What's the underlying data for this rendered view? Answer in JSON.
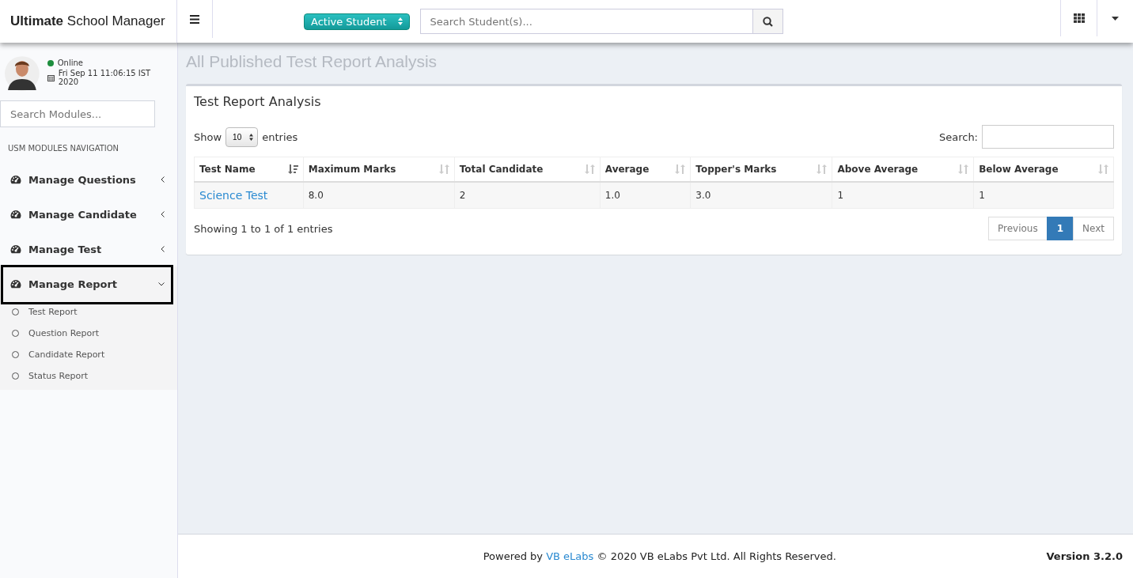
{
  "header": {
    "logo": "**Ultimate** School Manager",
    "status_select": "Active Student",
    "search": {
      "placeholder": "Search Student(s)..."
    }
  },
  "sidebar": {
    "user": {
      "status": "Online",
      "online": true,
      "datetime": "Fri Sep 11 11:06:15 IST 2020"
    },
    "search": {
      "placeholder": "Search Modules..."
    },
    "section": "USM MODULES NAVIGATION",
    "items": [
      {
        "label": "Manage Questions",
        "expanded": false,
        "highlighted": false
      },
      {
        "label": "Manage Candidate",
        "expanded": false,
        "highlighted": false
      },
      {
        "label": "Manage Test",
        "expanded": false,
        "highlighted": false
      },
      {
        "label": "Manage Report",
        "expanded": true,
        "highlighted": true,
        "children": [
          {
            "label": "Test Report"
          },
          {
            "label": "Question Report"
          },
          {
            "label": "Candidate Report"
          },
          {
            "label": "Status Report"
          }
        ]
      }
    ]
  },
  "page_title": "All Published Test Report Analysis",
  "panel": {
    "title": "Test Report Analysis",
    "length": {
      "before": "Show",
      "value": "10",
      "after": "entries"
    },
    "search_label": "Search:",
    "table": {
      "columns": [
        {
          "label": "Test Name",
          "sorted": true
        },
        {
          "label": "Maximum Marks",
          "sorted": false
        },
        {
          "label": "Total Candidate",
          "sorted": false
        },
        {
          "label": "Average",
          "sorted": false
        },
        {
          "label": "Topper's Marks",
          "sorted": false
        },
        {
          "label": "Above Average",
          "sorted": false
        },
        {
          "label": "Below Average",
          "sorted": false
        }
      ],
      "rows": [
        [
          "Science Test",
          "8.0",
          "2",
          "1.0",
          "3.0",
          "1",
          "1"
        ]
      ]
    },
    "info": "Showing 1 to 1 of 1 entries",
    "pagination": [
      {
        "label": "Previous",
        "kind": "nav",
        "selected": false
      },
      {
        "label": "1",
        "kind": "page",
        "selected": true
      },
      {
        "label": "Next",
        "kind": "nav",
        "selected": false
      }
    ]
  },
  "footer": {
    "before": "Powered by",
    "link": "VB eLabs",
    "after": "© 2020 VB eLabs Pvt Ltd. All Rights Reserved.",
    "version": "Version 3.2.0"
  }
}
